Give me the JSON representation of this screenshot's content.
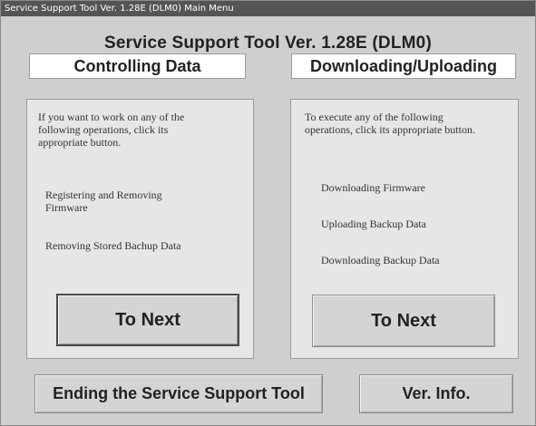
{
  "window": {
    "title": "Service Support Tool Ver. 1.28E (DLM0)   Main Menu"
  },
  "app_title": "Service Support Tool Ver. 1.28E (DLM0)",
  "left_section": {
    "header": "Controlling Data",
    "intro_line1": "If you want to work on any of the",
    "intro_line2": "following operations, click its",
    "intro_line3": "appropriate button.",
    "items": [
      {
        "line1": "Registering and Removing",
        "line2": "Firmware"
      },
      {
        "line1": "Removing Stored Bachup Data"
      }
    ],
    "next_button": "To Next"
  },
  "right_section": {
    "header": "Downloading/Uploading",
    "intro_line1": "To execute any of the following",
    "intro_line2": "operations, click its appropriate button.",
    "items": [
      {
        "label": "Downloading Firmware"
      },
      {
        "label": "Uploading Backup Data"
      },
      {
        "label": "Downloading Backup Data"
      }
    ],
    "next_button": "To Next"
  },
  "bottom": {
    "end_button": "Ending the Service Support Tool",
    "ver_button": "Ver. Info."
  }
}
